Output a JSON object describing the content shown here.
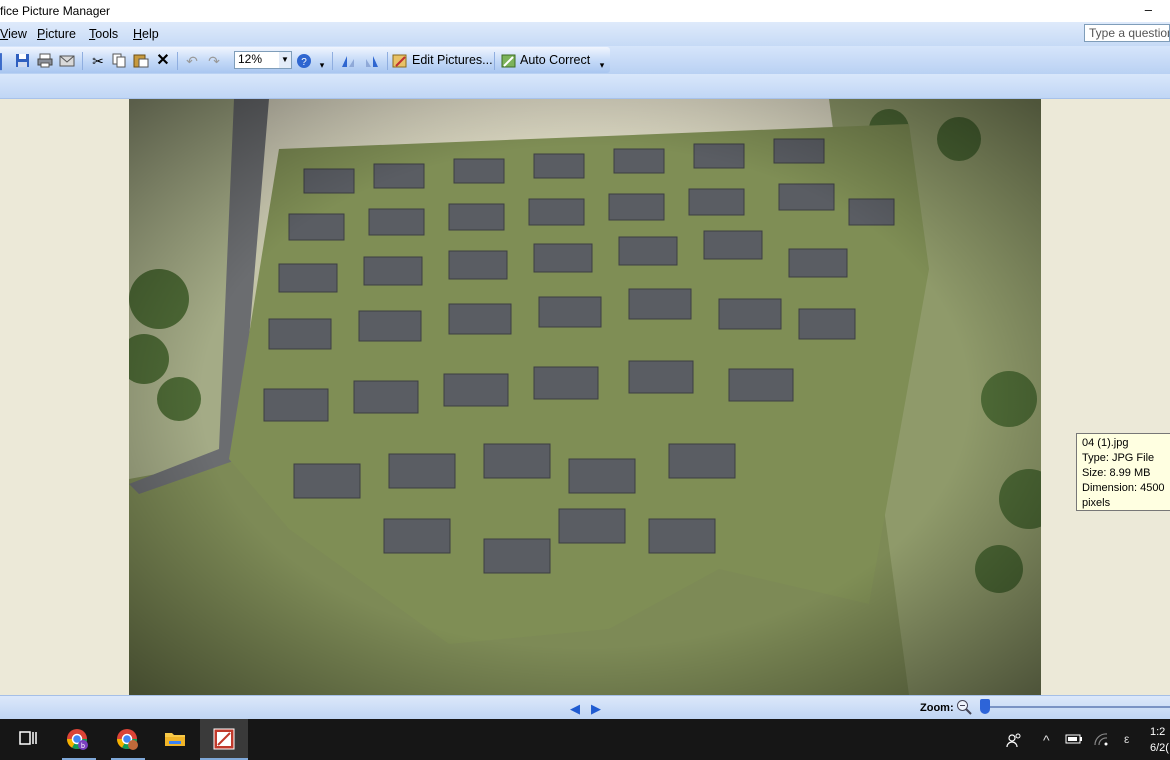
{
  "window": {
    "title": "fice Picture Manager",
    "minimize": "–"
  },
  "menu": {
    "items": [
      {
        "label": "View",
        "accel": "V"
      },
      {
        "label": "Picture",
        "accel": "P"
      },
      {
        "label": "Tools",
        "accel": "T"
      },
      {
        "label": "Help",
        "accel": "H"
      }
    ],
    "help_placeholder": "Type a question"
  },
  "toolbar": {
    "zoom_value": "12%",
    "edit_pictures_label": "Edit Pictures...",
    "auto_correct_label": "Auto Correct"
  },
  "tooltip": {
    "lines": [
      "04 (1).jpg",
      "Type: JPG File",
      "Size: 8.99 MB",
      "Dimension: 4500",
      "pixels"
    ]
  },
  "statusbar": {
    "zoom_label": "Zoom:"
  },
  "taskbar": {
    "clock_time": "1:2",
    "clock_date": "6/2("
  },
  "colors": {
    "accent": "#2d64d8",
    "menubar": "#c6daf6",
    "background": "#ece9d8",
    "taskbar": "#161616"
  }
}
